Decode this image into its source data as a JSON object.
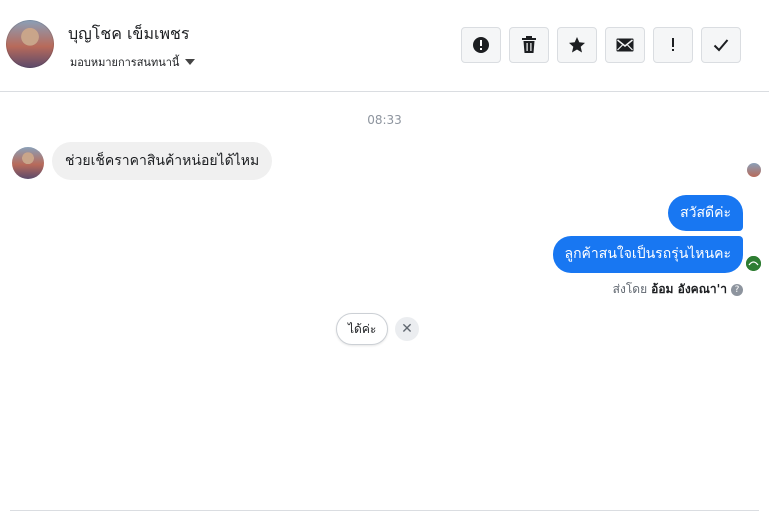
{
  "header": {
    "contact_name": "บุญโชค เข็มเพชร",
    "assign_label": "มอบหมายการสนทนานี้",
    "actions": [
      {
        "name": "spam-button",
        "icon": "exclamation-circle-icon"
      },
      {
        "name": "delete-button",
        "icon": "trash-icon"
      },
      {
        "name": "star-button",
        "icon": "star-icon"
      },
      {
        "name": "mark-unread-button",
        "icon": "envelope-icon"
      },
      {
        "name": "follow-up-button",
        "icon": "exclamation-icon"
      },
      {
        "name": "mark-done-button",
        "icon": "checkmark-icon"
      }
    ]
  },
  "thread": {
    "timestamp": "08:33",
    "incoming": [
      {
        "text": "ช่วยเช็คราคาสินค้าหน่อยได้ไหม"
      }
    ],
    "outgoing": [
      {
        "text": "สวัสดีค่ะ"
      },
      {
        "text": "ลูกค้าสนใจเป็นรถรุ่นไหนคะ"
      }
    ],
    "sent_by_prefix": "ส่งโดย",
    "sent_by_name": "อ้อม อังคณา'า",
    "help_glyph": "?"
  },
  "quick_reply": {
    "label": "ได้ค่ะ",
    "dismiss_glyph": "✕"
  },
  "colors": {
    "outgoing_bubble": "#1877f2",
    "incoming_bubble": "#f0f0f0"
  }
}
